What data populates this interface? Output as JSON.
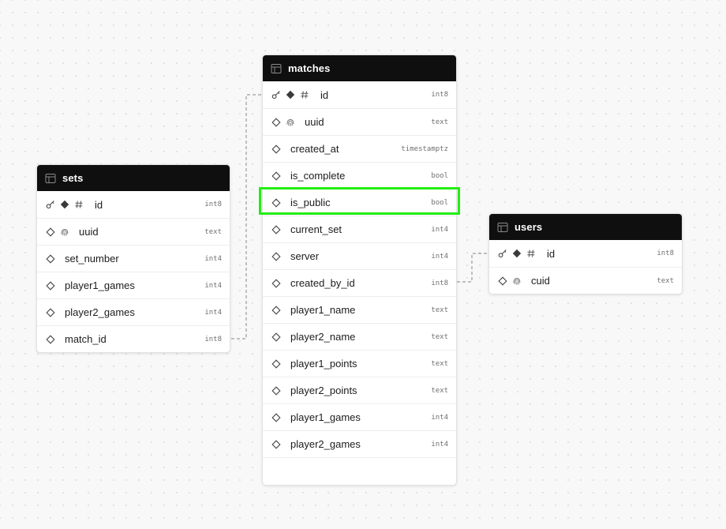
{
  "colors": {
    "header_bg": "#0f0f0f",
    "canvas_bg": "#f8f8f8",
    "highlight": "#22ee11",
    "connector": "#9a9a9a"
  },
  "tables": {
    "sets": {
      "title": "sets",
      "columns": [
        {
          "name": "id",
          "type": "int8",
          "icons": [
            "key-icon",
            "primary-diamond-icon",
            "hash-icon"
          ]
        },
        {
          "name": "uuid",
          "type": "text",
          "icons": [
            "nullable-diamond-icon",
            "fingerprint-icon"
          ]
        },
        {
          "name": "set_number",
          "type": "int4",
          "icons": [
            "nullable-diamond-icon"
          ]
        },
        {
          "name": "player1_games",
          "type": "int4",
          "icons": [
            "nullable-diamond-icon"
          ]
        },
        {
          "name": "player2_games",
          "type": "int4",
          "icons": [
            "nullable-diamond-icon"
          ]
        },
        {
          "name": "match_id",
          "type": "int8",
          "icons": [
            "nullable-diamond-icon"
          ]
        }
      ]
    },
    "matches": {
      "title": "matches",
      "columns": [
        {
          "name": "id",
          "type": "int8",
          "icons": [
            "key-icon",
            "primary-diamond-icon",
            "hash-icon"
          ]
        },
        {
          "name": "uuid",
          "type": "text",
          "icons": [
            "nullable-diamond-icon",
            "fingerprint-icon"
          ]
        },
        {
          "name": "created_at",
          "type": "timestamptz",
          "icons": [
            "nullable-diamond-icon"
          ]
        },
        {
          "name": "is_complete",
          "type": "bool",
          "icons": [
            "nullable-diamond-icon"
          ]
        },
        {
          "name": "is_public",
          "type": "bool",
          "icons": [
            "nullable-diamond-icon"
          ]
        },
        {
          "name": "current_set",
          "type": "int4",
          "icons": [
            "nullable-diamond-icon"
          ]
        },
        {
          "name": "server",
          "type": "int4",
          "icons": [
            "nullable-diamond-icon"
          ]
        },
        {
          "name": "created_by_id",
          "type": "int8",
          "icons": [
            "nullable-diamond-icon"
          ]
        },
        {
          "name": "player1_name",
          "type": "text",
          "icons": [
            "nullable-diamond-icon"
          ]
        },
        {
          "name": "player2_name",
          "type": "text",
          "icons": [
            "nullable-diamond-icon"
          ]
        },
        {
          "name": "player1_points",
          "type": "text",
          "icons": [
            "nullable-diamond-icon"
          ]
        },
        {
          "name": "player2_points",
          "type": "text",
          "icons": [
            "nullable-diamond-icon"
          ]
        },
        {
          "name": "player1_games",
          "type": "int4",
          "icons": [
            "nullable-diamond-icon"
          ]
        },
        {
          "name": "player2_games",
          "type": "int4",
          "icons": [
            "nullable-diamond-icon"
          ]
        }
      ]
    },
    "users": {
      "title": "users",
      "columns": [
        {
          "name": "id",
          "type": "int8",
          "icons": [
            "key-icon",
            "primary-diamond-icon",
            "hash-icon"
          ]
        },
        {
          "name": "cuid",
          "type": "text",
          "icons": [
            "nullable-diamond-icon",
            "fingerprint-icon"
          ]
        }
      ]
    }
  }
}
